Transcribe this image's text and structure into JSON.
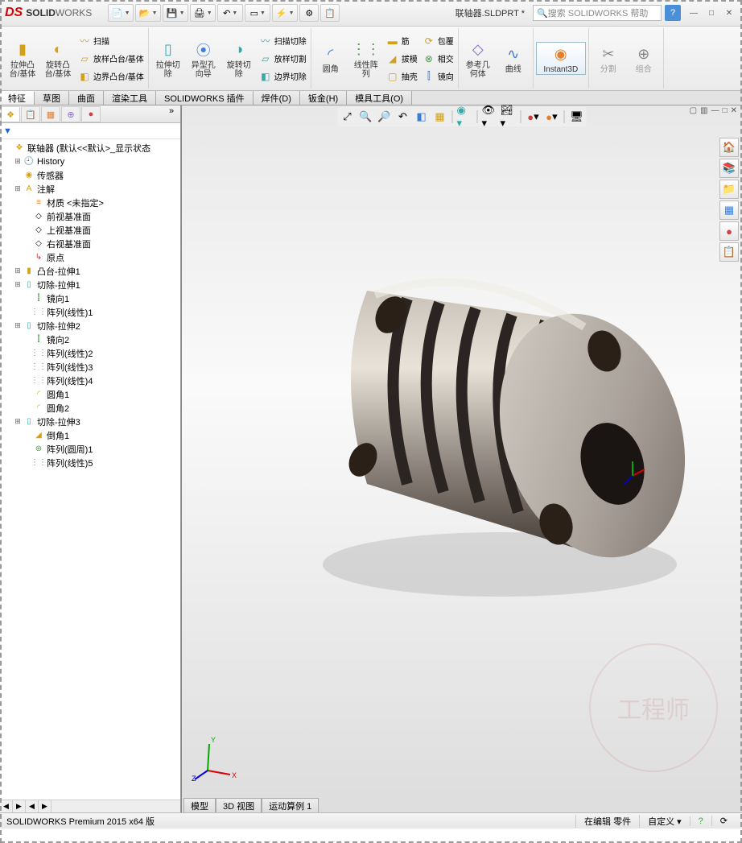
{
  "app": {
    "name_bold": "SOLID",
    "name_thin": "WORKS"
  },
  "title": {
    "document": "联轴器.SLDPRT *"
  },
  "search": {
    "placeholder": "搜索 SOLIDWORKS 帮助"
  },
  "ribbon": {
    "extrude": "拉伸凸\n台/基体",
    "revolve": "旋转凸\n台/基体",
    "sweep": "扫描",
    "loft": "放样凸台/基体",
    "boundary": "边界凸台/基体",
    "extrude_cut": "拉伸切\n除",
    "hole_wizard": "异型孔\n向导",
    "revolve_cut": "旋转切\n除",
    "sweep_cut": "扫描切除",
    "loft_cut": "放样切割",
    "boundary_cut": "边界切除",
    "fillet": "圆角",
    "linear_pattern": "线性阵\n列",
    "rib": "筋",
    "draft": "拔模",
    "shell": "抽壳",
    "wrap": "包覆",
    "intersect": "相交",
    "mirror": "镜向",
    "ref_geom": "参考几\n何体",
    "curves": "曲线",
    "instant3d": "Instant3D",
    "split": "分割",
    "combine": "组合"
  },
  "tabs": {
    "features": "特征",
    "sketch": "草图",
    "surfaces": "曲面",
    "render": "渲染工具",
    "addins": "SOLIDWORKS 插件",
    "weldments": "焊件(D)",
    "sheetmetal": "钣金(H)",
    "mold": "模具工具(O)"
  },
  "tree": {
    "root": "联轴器  (默认<<默认>_显示状态",
    "history": "History",
    "sensors": "传感器",
    "annotations": "注解",
    "material": "材质 <未指定>",
    "front": "前视基准面",
    "top": "上视基准面",
    "right": "右视基准面",
    "origin": "原点",
    "items": [
      "凸台-拉伸1",
      "切除-拉伸1",
      "镜向1",
      "阵列(线性)1",
      "切除-拉伸2",
      "镜向2",
      "阵列(线性)2",
      "阵列(线性)3",
      "阵列(线性)4",
      "圆角1",
      "圆角2",
      "切除-拉伸3",
      "倒角1",
      "阵列(圆周)1",
      "阵列(线性)5"
    ]
  },
  "bottom_tabs": {
    "model": "模型",
    "view3d": "3D 视图",
    "motion": "运动算例 1"
  },
  "status": {
    "version": "SOLIDWORKS Premium 2015 x64 版",
    "editing": "在编辑 零件",
    "custom": "自定义"
  }
}
